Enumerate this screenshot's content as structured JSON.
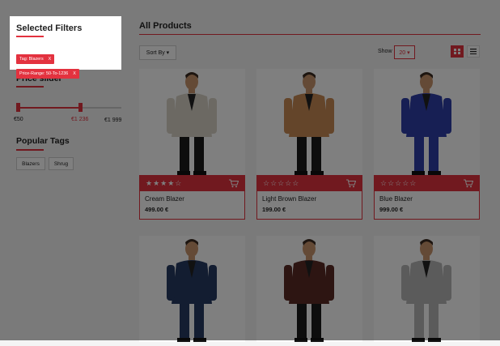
{
  "filters": {
    "title": "Selected Filters",
    "chips": [
      {
        "label": "Tag: Blazers",
        "close": "X"
      },
      {
        "label": "Price-Range: 50-To-1236",
        "close": "X"
      }
    ]
  },
  "price_slider": {
    "title": "Price slider",
    "min_label": "€50",
    "selected_max_label": "€1 236",
    "max_label": "€1 999",
    "range_fraction": [
      0,
      0.6
    ]
  },
  "popular_tags": {
    "title": "Popular Tags",
    "tags": [
      "Blazers",
      "Shrug"
    ]
  },
  "main": {
    "title": "All Products",
    "sort_by": "Sort By ▾",
    "show_label": "Show",
    "show_value": "20 ▾"
  },
  "products": [
    {
      "name": "Cream Blazer",
      "price": "499.00 €",
      "rating": 4,
      "suit_color": "#d9d3c7",
      "trouser_color": "#1b1b1b"
    },
    {
      "name": "Light Brown Blazer",
      "price": "199.00 €",
      "rating": 0,
      "suit_color": "#c98b55",
      "trouser_color": "#1b1b1b"
    },
    {
      "name": "Blue Blazer",
      "price": "999.00 €",
      "rating": 0,
      "suit_color": "#2f3ea8",
      "trouser_color": "#2f3ea8"
    },
    {
      "suit_color": "#263a63",
      "trouser_color": "#263a63"
    },
    {
      "suit_color": "#5a2a25",
      "trouser_color": "#1b1b1b"
    },
    {
      "suit_color": "#b7b7b7",
      "trouser_color": "#b7b7b7"
    }
  ],
  "colors": {
    "accent": "#e3323f"
  }
}
